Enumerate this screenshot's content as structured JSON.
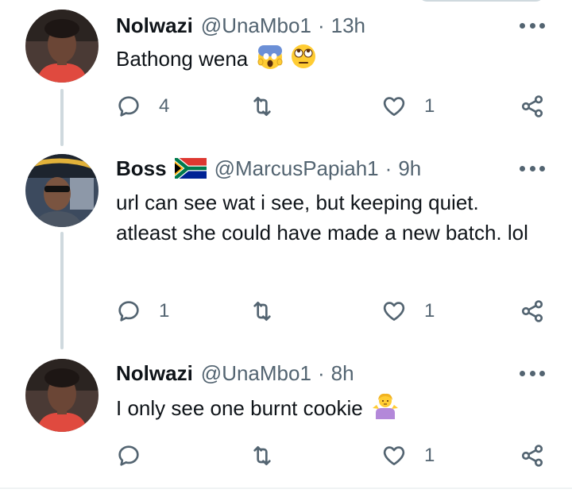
{
  "tweets": [
    {
      "name": "Nolwazi",
      "handle": "@UnaMbo1",
      "separator": "·",
      "time": "13h",
      "text": "Bathong wena",
      "emojis": [
        "face-screaming-in-fear",
        "face-with-rolling-eyes"
      ],
      "replies": "4",
      "retweets": "",
      "likes": "1"
    },
    {
      "name": "Boss",
      "flag": "south-africa-flag",
      "handle": "@MarcusPapiah1",
      "separator": "·",
      "time": "9h",
      "text": "url can see wat i see, but keeping quiet. atleast she could have made a new batch. lol",
      "replies": "1",
      "retweets": "",
      "likes": "1"
    },
    {
      "name": "Nolwazi",
      "handle": "@UnaMbo1",
      "separator": "·",
      "time": "8h",
      "text": "I only see one burnt cookie",
      "emojis": [
        "person-shrugging"
      ],
      "replies": "",
      "retweets": "",
      "likes": "1"
    }
  ],
  "icons": {
    "reply": "reply-icon",
    "retweet": "retweet-icon",
    "like": "heart-icon",
    "share": "share-icon",
    "more": "more-options-icon"
  },
  "colors": {
    "text": "#0f1419",
    "secondary": "#536471",
    "thread_line": "#cfd9de",
    "divider": "#eff3f4"
  }
}
